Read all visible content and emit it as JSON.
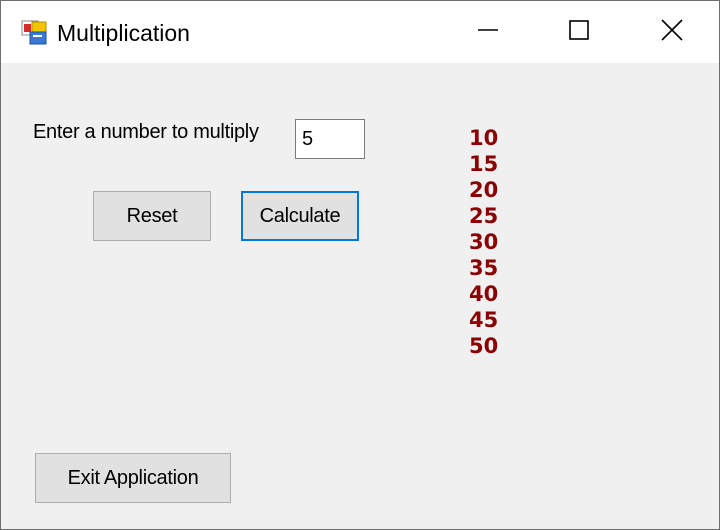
{
  "window": {
    "title": "Multiplication",
    "icon": "app-window-icon",
    "controls": [
      "minimize-icon",
      "maximize-icon",
      "close-icon"
    ]
  },
  "form": {
    "prompt_label": "Enter a number to multiply",
    "number_value": "5",
    "reset_label": "Reset",
    "calculate_label": "Calculate",
    "exit_label": "Exit Application"
  },
  "results": [
    "10",
    "15",
    "20",
    "25",
    "30",
    "35",
    "40",
    "45",
    "50"
  ],
  "colors": {
    "result_text": "#8b0000",
    "focus_border": "#0078d7",
    "window_bg": "#f0f0f0"
  }
}
